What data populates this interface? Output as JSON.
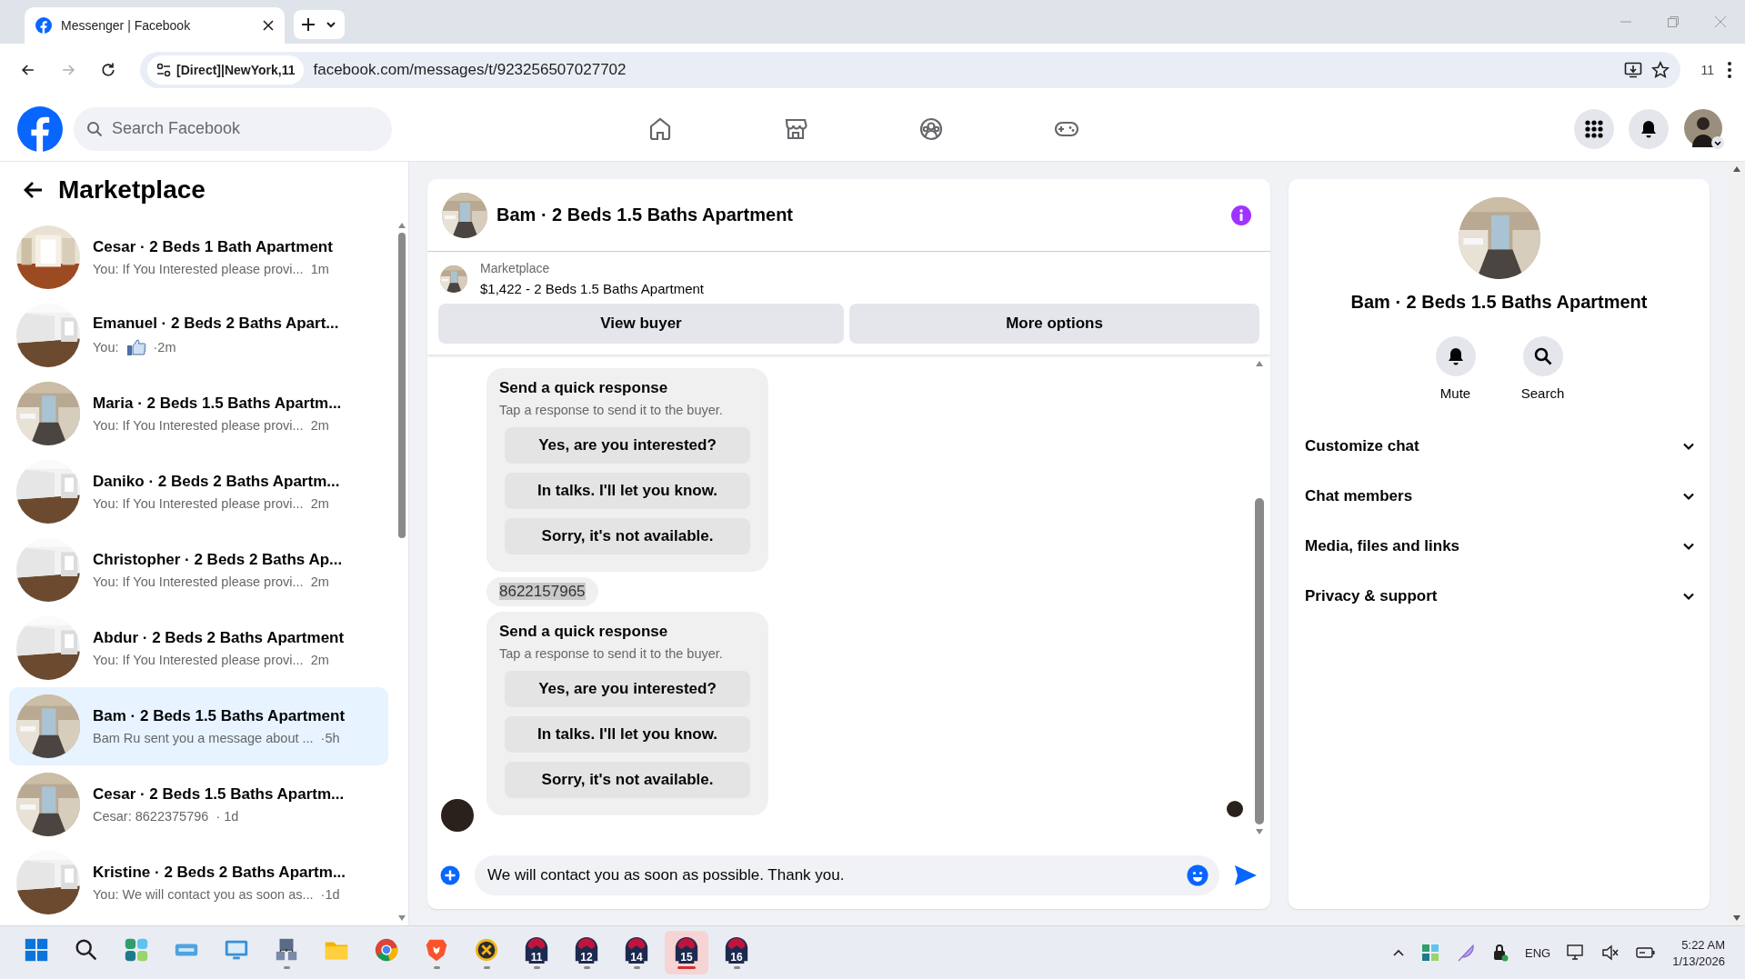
{
  "browser": {
    "tab": {
      "title": "Messenger | Facebook",
      "selected": true
    },
    "nav": [
      {
        "kind": "back",
        "disabled": false
      },
      {
        "kind": "forward",
        "disabled": true
      },
      {
        "kind": "reload",
        "disabled": false
      }
    ],
    "site_chip": "[Direct]|NewYork,11",
    "url": "facebook.com/messages/t/923256507027702",
    "extensions_count": "11"
  },
  "header": {
    "search": {
      "placeholder": "Search Facebook"
    },
    "nav": [
      {
        "kind": "home"
      },
      {
        "kind": "store"
      },
      {
        "kind": "groups"
      },
      {
        "kind": "gaming"
      }
    ]
  },
  "sidebar": {
    "title": "Marketplace",
    "conversations": [
      {
        "name": "Cesar · 2 Beds 1 Bath Apartment",
        "kind": "text",
        "preview": "You: If You Interested please provi...",
        "time": "1m",
        "selected": false
      },
      {
        "name": "Emanuel · 2 Beds 2 Baths Apart...",
        "kind": "like",
        "preview": "You:",
        "time": "·2m",
        "selected": false
      },
      {
        "name": "Maria · 2 Beds 1.5 Baths Apartm...",
        "kind": "text",
        "preview": "You: If You Interested please provi...",
        "time": "2m",
        "selected": false
      },
      {
        "name": "Daniko · 2 Beds 2 Baths Apartm...",
        "kind": "text",
        "preview": "You: If You Interested please provi...",
        "time": "2m",
        "selected": false
      },
      {
        "name": "Christopher · 2 Beds 2 Baths Ap...",
        "kind": "text",
        "preview": "You: If You Interested please provi...",
        "time": "2m",
        "selected": false
      },
      {
        "name": "Abdur · 2 Beds 2 Baths Apartment",
        "kind": "text",
        "preview": "You: If You Interested please provi...",
        "time": "2m",
        "selected": false
      },
      {
        "name": "Bam · 2 Beds 1.5 Baths Apartment",
        "kind": "text",
        "preview": "Bam Ru sent you a message about ...",
        "time": "·5h",
        "selected": true
      },
      {
        "name": "Cesar · 2 Beds 1.5 Baths Apartm...",
        "kind": "text",
        "preview": "Cesar: 8622375796",
        "time": "· 1d",
        "selected": false
      },
      {
        "name": "Kristine · 2 Beds 2 Baths Apartm...",
        "kind": "text",
        "preview": "You: We will contact you as soon as...",
        "time": "·1d",
        "selected": false
      }
    ]
  },
  "chat": {
    "title": "Bam · 2 Beds 1.5 Baths Apartment",
    "listing": {
      "source": "Marketplace",
      "summary": "$1,422 - 2 Beds 1.5 Baths Apartment",
      "buttons": [
        "View buyer",
        "More options"
      ]
    },
    "messages": [
      {
        "kind": "quick_responses",
        "title": "Send a quick response",
        "subtitle": "Tap a response to send it to the buyer.",
        "options": [
          "Yes, are you interested?",
          "In talks. I'll let you know.",
          "Sorry, it's not available."
        ]
      },
      {
        "kind": "text",
        "text": "8622157965",
        "highlighted": true
      },
      {
        "kind": "quick_responses",
        "title": "Send a quick response",
        "subtitle": "Tap a response to send it to the buyer.",
        "options": [
          "Yes, are you interested?",
          "In talks. I'll let you know.",
          "Sorry, it's not available."
        ]
      }
    ],
    "composer": {
      "value": "We will contact you as soon as possible. Thank you."
    }
  },
  "details": {
    "title": "Bam · 2 Beds 1.5 Baths Apartment",
    "actions": [
      {
        "kind": "mute",
        "label": "Mute"
      },
      {
        "kind": "search",
        "label": "Search"
      }
    ],
    "sections": [
      {
        "label": "Customize chat",
        "expanded": false
      },
      {
        "label": "Chat members",
        "expanded": false
      },
      {
        "label": "Media, files and links",
        "expanded": false
      },
      {
        "label": "Privacy & support",
        "expanded": false
      }
    ]
  },
  "taskbar": {
    "apps": [
      {
        "kind": "start",
        "running": false,
        "selected": false
      },
      {
        "kind": "search",
        "running": false,
        "selected": false
      },
      {
        "kind": "widgets",
        "running": false,
        "selected": false
      },
      {
        "kind": "drive",
        "running": false,
        "selected": false
      },
      {
        "kind": "monitor",
        "running": false,
        "selected": false
      },
      {
        "kind": "network",
        "running": true,
        "selected": false
      },
      {
        "kind": "folder",
        "running": false,
        "selected": false
      },
      {
        "kind": "chrome",
        "running": false,
        "selected": false
      },
      {
        "kind": "brave",
        "running": true,
        "selected": false
      },
      {
        "kind": "ix",
        "running": true,
        "selected": false
      },
      {
        "kind": "profile",
        "label": "11",
        "running": true,
        "selected": false
      },
      {
        "kind": "profile",
        "label": "12",
        "running": true,
        "selected": false
      },
      {
        "kind": "profile",
        "label": "14",
        "running": true,
        "selected": false
      },
      {
        "kind": "profile",
        "label": "15",
        "running": true,
        "selected": true
      },
      {
        "kind": "profile",
        "label": "16",
        "running": true,
        "selected": false
      }
    ],
    "language": "ENG",
    "time": "5:22 AM",
    "date": "1/13/2026"
  }
}
